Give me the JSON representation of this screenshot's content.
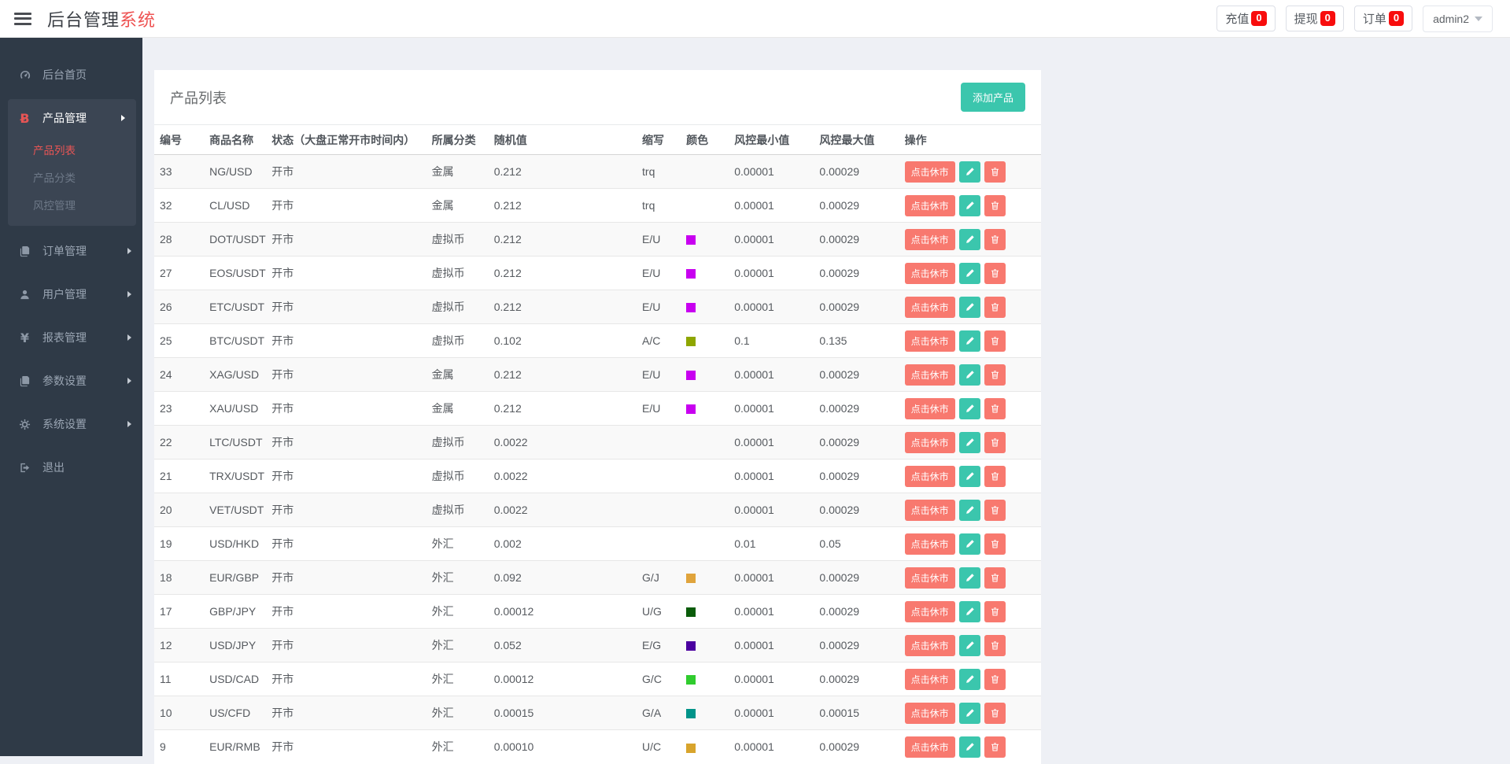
{
  "topbar": {
    "title_dark": "后台管理",
    "title_red": "系统",
    "buttons": [
      {
        "name": "recharge",
        "label": "充值",
        "count": "0"
      },
      {
        "name": "withdraw",
        "label": "提现",
        "count": "0"
      },
      {
        "name": "orders",
        "label": "订单",
        "count": "0"
      }
    ],
    "user": "admin2"
  },
  "sidebar": {
    "items": [
      {
        "name": "dashboard",
        "label": "后台首页",
        "icon": "dashboard-icon"
      },
      {
        "name": "product-management",
        "label": "产品管理",
        "icon": "bitcoin-icon",
        "expanded": true,
        "children": [
          {
            "name": "product-list",
            "label": "产品列表",
            "active": true
          },
          {
            "name": "product-category",
            "label": "产品分类"
          },
          {
            "name": "risk-management",
            "label": "风控管理"
          }
        ]
      },
      {
        "name": "order-management",
        "label": "订单管理",
        "icon": "files-icon",
        "arrow": true
      },
      {
        "name": "user-management",
        "label": "用户管理",
        "icon": "user-icon",
        "arrow": true
      },
      {
        "name": "report-management",
        "label": "报表管理",
        "icon": "yen-icon",
        "arrow": true
      },
      {
        "name": "parameter-settings",
        "label": "参数设置",
        "icon": "files-icon",
        "arrow": true
      },
      {
        "name": "system-settings",
        "label": "系统设置",
        "icon": "gears-icon",
        "arrow": true
      },
      {
        "name": "logout",
        "label": "退出",
        "icon": "signout-icon"
      }
    ]
  },
  "panel": {
    "title": "产品列表",
    "add_button": "添加产品"
  },
  "table": {
    "columns": [
      "编号",
      "商品名称",
      "状态（大盘正常开市时间内）",
      "所属分类",
      "随机值",
      "缩写",
      "颜色",
      "风控最小值",
      "风控最大值",
      "操作"
    ],
    "action_labels": {
      "close_market": "点击休市"
    },
    "rows": [
      {
        "id": "33",
        "name": "NG/USD",
        "status": "开市",
        "category": "金属",
        "random": "0.212",
        "abbr": "trq",
        "color": "",
        "min": "0.00001",
        "max": "0.00029"
      },
      {
        "id": "32",
        "name": "CL/USD",
        "status": "开市",
        "category": "金属",
        "random": "0.212",
        "abbr": "trq",
        "color": "",
        "min": "0.00001",
        "max": "0.00029"
      },
      {
        "id": "28",
        "name": "DOT/USDT",
        "status": "开市",
        "category": "虚拟币",
        "random": "0.212",
        "abbr": "E/U",
        "color": "#c800f0",
        "min": "0.00001",
        "max": "0.00029"
      },
      {
        "id": "27",
        "name": "EOS/USDT",
        "status": "开市",
        "category": "虚拟币",
        "random": "0.212",
        "abbr": "E/U",
        "color": "#c800f0",
        "min": "0.00001",
        "max": "0.00029"
      },
      {
        "id": "26",
        "name": "ETC/USDT",
        "status": "开市",
        "category": "虚拟币",
        "random": "0.212",
        "abbr": "E/U",
        "color": "#c800f0",
        "min": "0.00001",
        "max": "0.00029"
      },
      {
        "id": "25",
        "name": "BTC/USDT",
        "status": "开市",
        "category": "虚拟币",
        "random": "0.102",
        "abbr": "A/C",
        "color": "#8ea600",
        "min": "0.1",
        "max": "0.135"
      },
      {
        "id": "24",
        "name": "XAG/USD",
        "status": "开市",
        "category": "金属",
        "random": "0.212",
        "abbr": "E/U",
        "color": "#c800f0",
        "min": "0.00001",
        "max": "0.00029"
      },
      {
        "id": "23",
        "name": "XAU/USD",
        "status": "开市",
        "category": "金属",
        "random": "0.212",
        "abbr": "E/U",
        "color": "#c800f0",
        "min": "0.00001",
        "max": "0.00029"
      },
      {
        "id": "22",
        "name": "LTC/USDT",
        "status": "开市",
        "category": "虚拟币",
        "random": "0.0022",
        "abbr": "",
        "color": "",
        "min": "0.00001",
        "max": "0.00029"
      },
      {
        "id": "21",
        "name": "TRX/USDT",
        "status": "开市",
        "category": "虚拟币",
        "random": "0.0022",
        "abbr": "",
        "color": "",
        "min": "0.00001",
        "max": "0.00029"
      },
      {
        "id": "20",
        "name": "VET/USDT",
        "status": "开市",
        "category": "虚拟币",
        "random": "0.0022",
        "abbr": "",
        "color": "",
        "min": "0.00001",
        "max": "0.00029"
      },
      {
        "id": "19",
        "name": "USD/HKD",
        "status": "开市",
        "category": "外汇",
        "random": "0.002",
        "abbr": "",
        "color": "",
        "min": "0.01",
        "max": "0.05"
      },
      {
        "id": "18",
        "name": "EUR/GBP",
        "status": "开市",
        "category": "外汇",
        "random": "0.092",
        "abbr": "G/J",
        "color": "#e0a43c",
        "min": "0.00001",
        "max": "0.00029"
      },
      {
        "id": "17",
        "name": "GBP/JPY",
        "status": "开市",
        "category": "外汇",
        "random": "0.00012",
        "abbr": "U/G",
        "color": "#0a5c0a",
        "min": "0.00001",
        "max": "0.00029"
      },
      {
        "id": "12",
        "name": "USD/JPY",
        "status": "开市",
        "category": "外汇",
        "random": "0.052",
        "abbr": "E/G",
        "color": "#4b00a0",
        "min": "0.00001",
        "max": "0.00029"
      },
      {
        "id": "11",
        "name": "USD/CAD",
        "status": "开市",
        "category": "外汇",
        "random": "0.00012",
        "abbr": "G/C",
        "color": "#30cc2e",
        "min": "0.00001",
        "max": "0.00029"
      },
      {
        "id": "10",
        "name": "US/CFD",
        "status": "开市",
        "category": "外汇",
        "random": "0.00015",
        "abbr": "G/A",
        "color": "#00948a",
        "min": "0.00001",
        "max": "0.00015"
      },
      {
        "id": "9",
        "name": "EUR/RMB",
        "status": "开市",
        "category": "外汇",
        "random": "0.00010",
        "abbr": "U/C",
        "color": "#d8a42c",
        "min": "0.00001",
        "max": "0.00029"
      }
    ]
  },
  "colors": {
    "accent_red": "#ee5252",
    "badge_red": "#f80d0d",
    "teal": "#3bc6ad",
    "salmon": "#f8796f",
    "sidebar_bg": "#2f3a47"
  }
}
